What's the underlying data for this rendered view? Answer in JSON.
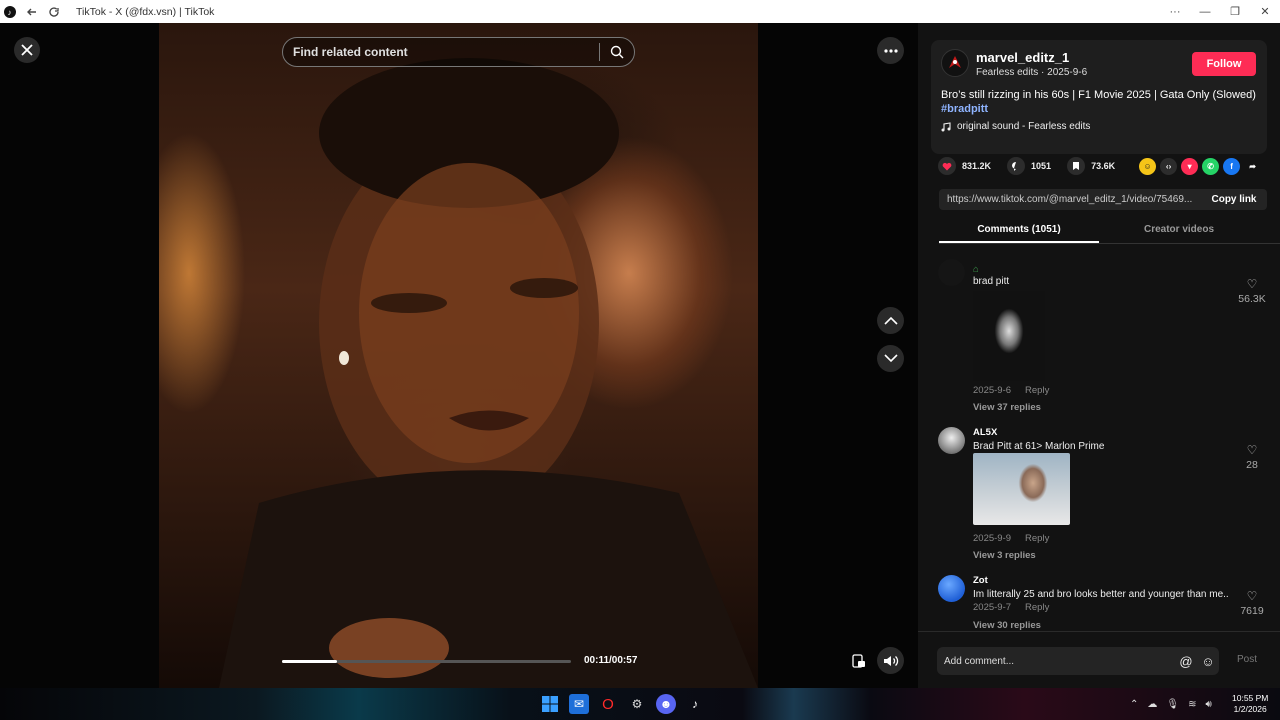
{
  "window": {
    "title": "TikTok - X (@fdx.vsn) | TikTok",
    "controls": [
      "···",
      "—",
      "❐",
      "✕"
    ]
  },
  "player": {
    "search_placeholder": "Find related content",
    "time": "00:11/00:57",
    "progress": 0.19
  },
  "video_info": {
    "username": "marvel_editz_1",
    "subline": "Fearless edits · 2025-9-6",
    "follow_label": "Follow",
    "description": "Bro’s still rizzing in his 60s | F1 Movie 2025 | Gata Only (Slowed)",
    "hashtag": "#bradpitt",
    "sound": "original sound - Fearless edits",
    "likes": "831.2K",
    "comments_count": "1051",
    "saves": "73.6K",
    "link": "https://www.tiktok.com/@marvel_editz_1/video/75469...",
    "copy_label": "Copy link"
  },
  "tabs": [
    {
      "label": "Comments (1051)",
      "active": true
    },
    {
      "label": "Creator videos",
      "active": false
    }
  ],
  "comments": [
    {
      "name": "",
      "text": "brad pitt",
      "date": "2025-9-6",
      "reply": "Reply",
      "replies": "View 37 replies",
      "likes": "56.3K"
    },
    {
      "name": "AL5X",
      "text": "Brad Pitt at 61> Marlon Prime",
      "date": "2025-9-9",
      "reply": "Reply",
      "replies": "View 3 replies",
      "likes": "28"
    },
    {
      "name": "Zot",
      "text": "Im litterally 25 and bro looks better and younger than me..",
      "date": "2025-9-7",
      "reply": "Reply",
      "replies": "View 30 replies",
      "likes": "7619"
    }
  ],
  "compose": {
    "placeholder": "Add comment...",
    "post_label": "Post"
  },
  "clock": {
    "time": "10:55 PM",
    "date": "1/2/2026"
  },
  "colors": {
    "follow": "#fe2c55",
    "hashtag": "#8fb4ff",
    "panel": "#121212"
  }
}
